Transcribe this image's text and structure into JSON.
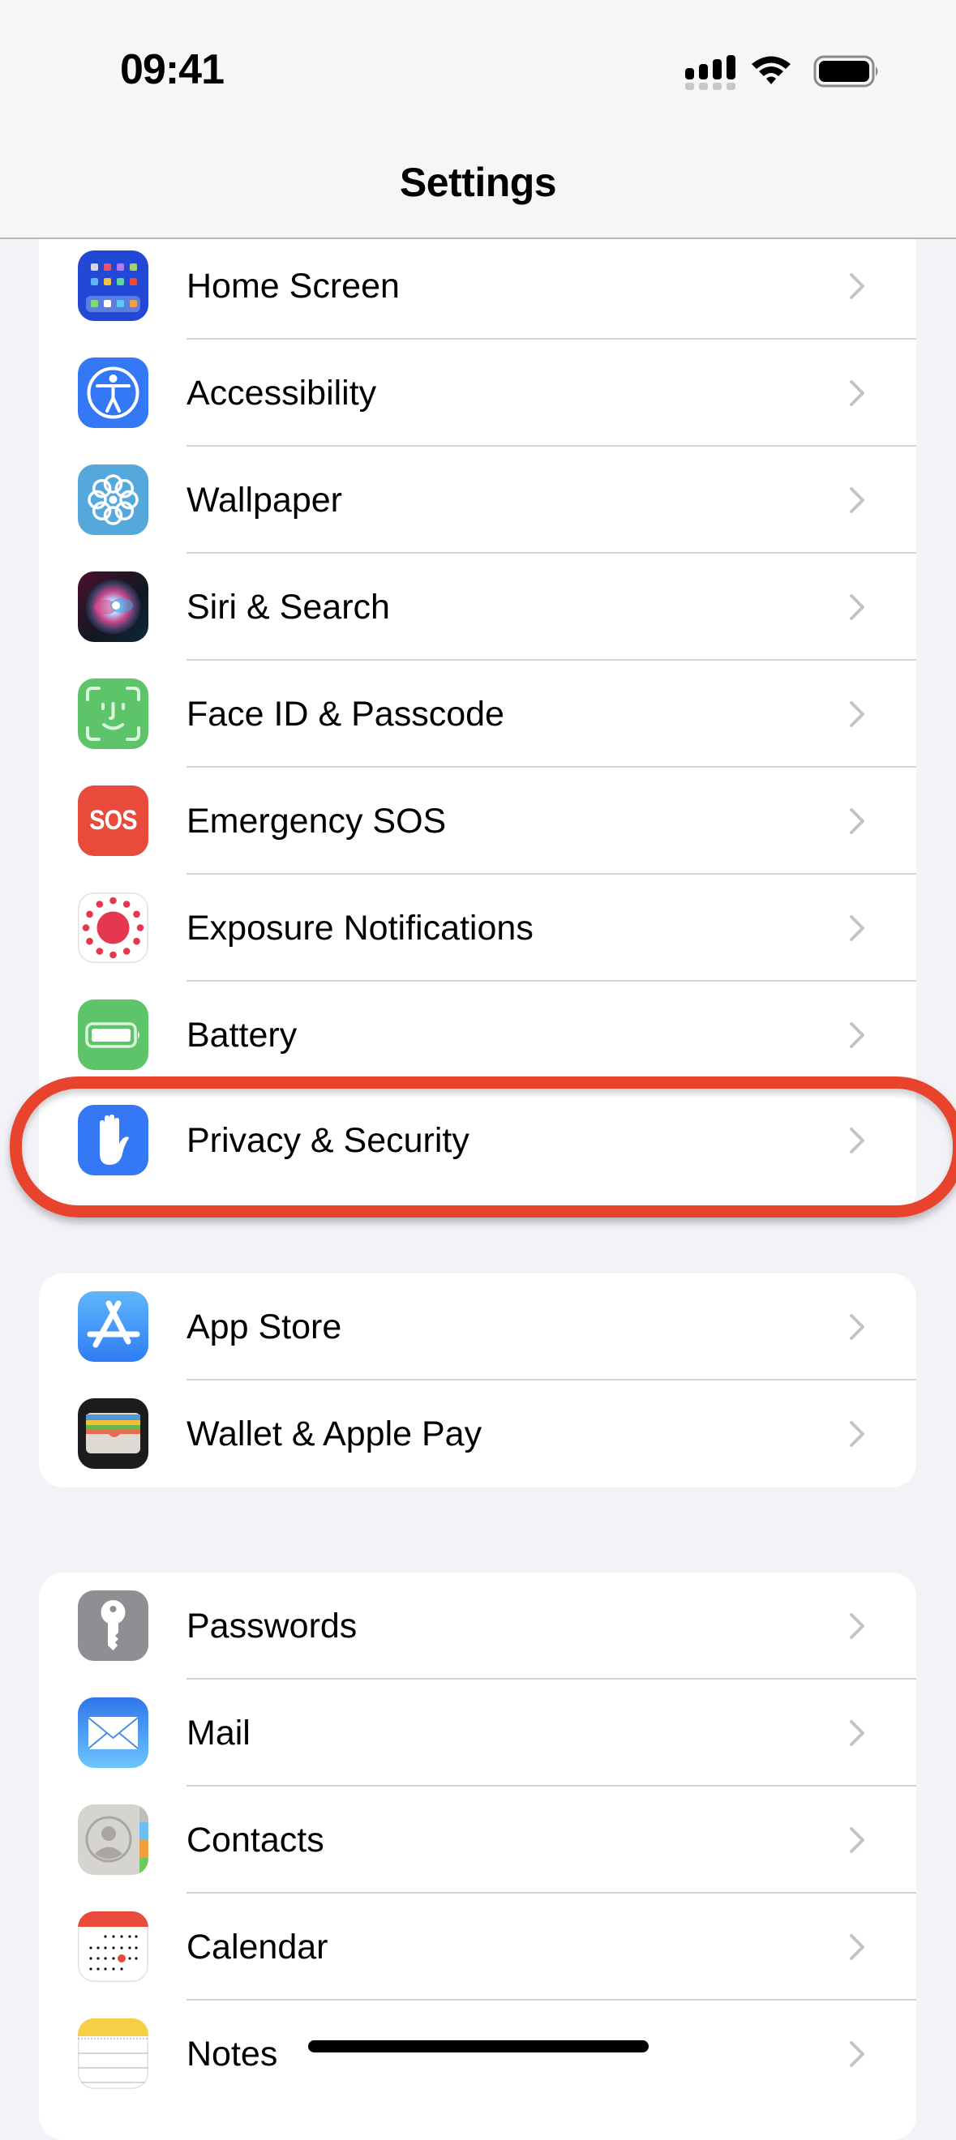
{
  "status_bar": {
    "time": "09:41",
    "signal_icon": "cellular-signal-icon",
    "wifi_icon": "wifi-icon",
    "battery_icon": "battery-icon"
  },
  "header": {
    "title": "Settings"
  },
  "groups": [
    {
      "items": [
        {
          "label": "Home Screen",
          "icon": "home-screen-icon",
          "color": "#2448d6"
        },
        {
          "label": "Accessibility",
          "icon": "accessibility-icon",
          "color": "#3478f6"
        },
        {
          "label": "Wallpaper",
          "icon": "wallpaper-icon",
          "color": "#55a8dc"
        },
        {
          "label": "Siri & Search",
          "icon": "siri-icon",
          "color": "#1f1f2e"
        },
        {
          "label": "Face ID & Passcode",
          "icon": "face-id-icon",
          "color": "#5ec46a"
        },
        {
          "label": "Emergency SOS",
          "icon": "sos-icon",
          "color": "#e84a3c",
          "icon_text": "SOS"
        },
        {
          "label": "Exposure Notifications",
          "icon": "exposure-notifications-icon",
          "color": "#ffffff"
        },
        {
          "label": "Battery",
          "icon": "battery-settings-icon",
          "color": "#5ec46a"
        },
        {
          "label": "Privacy & Security",
          "icon": "privacy-hand-icon",
          "color": "#3478f6",
          "highlighted": true
        }
      ]
    },
    {
      "items": [
        {
          "label": "App Store",
          "icon": "app-store-icon",
          "color": "#2f8df6"
        },
        {
          "label": "Wallet & Apple Pay",
          "icon": "wallet-icon",
          "color": "#1c1c1e"
        }
      ]
    },
    {
      "items": [
        {
          "label": "Passwords",
          "icon": "passwords-key-icon",
          "color": "#8e8e93"
        },
        {
          "label": "Mail",
          "icon": "mail-icon",
          "color": "#3b82f0"
        },
        {
          "label": "Contacts",
          "icon": "contacts-icon",
          "color": "#d6d4cf"
        },
        {
          "label": "Calendar",
          "icon": "calendar-icon",
          "color": "#ffffff"
        },
        {
          "label": "Notes",
          "icon": "notes-icon",
          "color": "#ffffff"
        }
      ]
    }
  ],
  "annotation": {
    "highlight_color": "#e8432d",
    "highlighted_item": "Privacy & Security"
  }
}
